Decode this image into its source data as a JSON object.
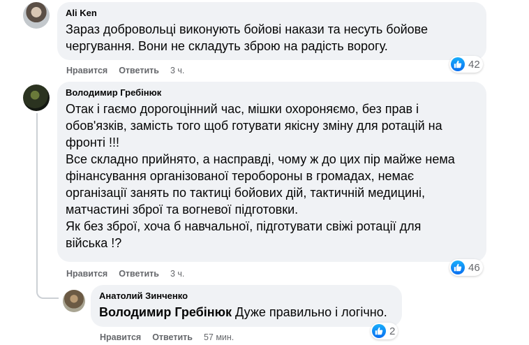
{
  "comments": [
    {
      "author": "Ali Ken",
      "text": "Зараз добровольці виконують бойові накази та несуть бойове\nчергування. Вони не складуть зброю на радість ворогу.",
      "like_label": "Нравится",
      "reply_label": "Ответить",
      "time": "3 ч.",
      "reactions": "42"
    },
    {
      "author": "Володимир Гребінюк",
      "text": "Отак і гаємо дорогоцінний час, мішки охороняємо, без прав і\nобов'язків, замість того щоб готувати якісну зміну для ротацій на\nфронті !!!\nВсе складно прийнято, а насправді, чому ж до цих пір майже нема\nфінансування організованої теробороны в громадах, немає\nорганізації занять по тактиці бойових дій, тактичній медицині,\nматчастині зброї та вогневої підготовки.\nЯк без зброї, хоча б навчальної, підготувати свіжі ротації для\nвійська !?",
      "like_label": "Нравится",
      "reply_label": "Ответить",
      "time": "3 ч.",
      "reactions": "46"
    }
  ],
  "reply": {
    "author": "Анатолий Зинченко",
    "mention": "Володимир Гребінюк",
    "text": " Дуже правильно і логічно.",
    "like_label": "Нравится",
    "reply_label": "Ответить",
    "time": "57 мин.",
    "reactions": "2"
  },
  "colors": {
    "bubble": "#f0f2f5",
    "meta": "#65676b",
    "like": "#1877f2"
  },
  "icons": [
    "avatar",
    "like-icon"
  ]
}
